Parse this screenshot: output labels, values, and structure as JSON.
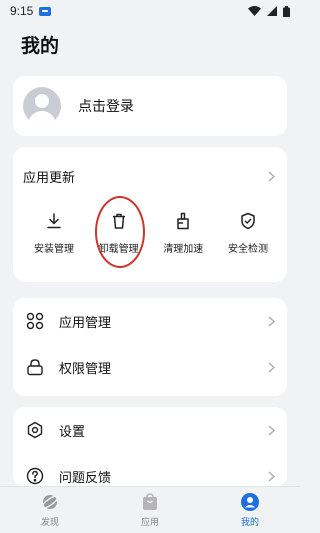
{
  "status_bar": {
    "time": "9:15"
  },
  "page": {
    "title": "我的"
  },
  "login": {
    "label": "点击登录"
  },
  "updates": {
    "title": "应用更新",
    "tools": [
      {
        "label": "安装管理",
        "icon": "download-icon"
      },
      {
        "label": "卸载管理",
        "icon": "trash-icon"
      },
      {
        "label": "清理加速",
        "icon": "broom-icon"
      },
      {
        "label": "安全检测",
        "icon": "shield-check-icon"
      }
    ]
  },
  "manage": {
    "items": [
      {
        "label": "应用管理",
        "icon": "grid-icon"
      },
      {
        "label": "权限管理",
        "icon": "lock-icon"
      }
    ]
  },
  "settings": {
    "items": [
      {
        "label": "设置",
        "icon": "gear-icon"
      },
      {
        "label": "问题反馈",
        "icon": "question-icon"
      }
    ]
  },
  "bottom_nav": {
    "items": [
      {
        "label": "发现",
        "icon": "planet-icon",
        "active": false
      },
      {
        "label": "应用",
        "icon": "bag-icon",
        "active": false
      },
      {
        "label": "我的",
        "icon": "profile-icon",
        "active": true
      }
    ],
    "active_color": "#1e6fe0"
  },
  "colors": {
    "accent": "#1e6fe0",
    "highlight_ring": "#c8372d"
  }
}
